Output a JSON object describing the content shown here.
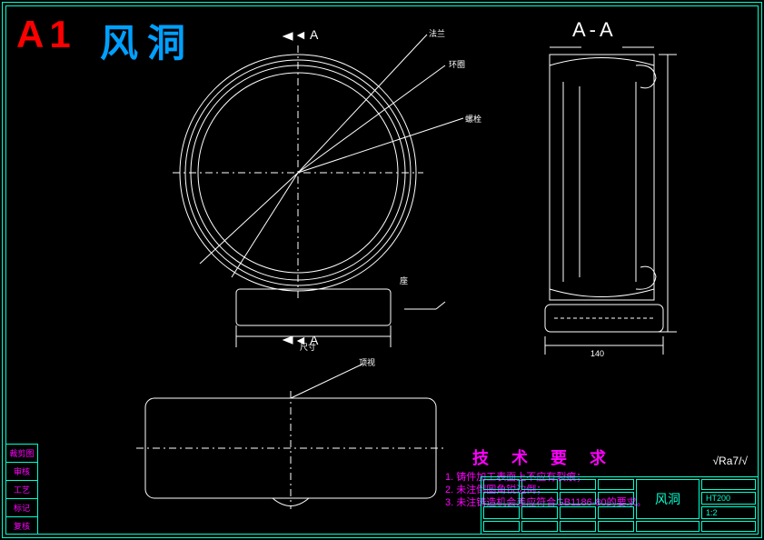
{
  "sheet": {
    "format": "A1",
    "title": "风洞",
    "section_label": "A-A",
    "arrow_label_top": "A",
    "arrow_label_bottom": "A"
  },
  "tech": {
    "heading": "技 术 要 求",
    "items": [
      "1. 铸件加工表面上不应有裂痕；",
      "2. 未注倒圆角锐边倒；",
      "3. 未注铸造机会差应符合GB1186-80的要求。"
    ]
  },
  "tolerance": "√Ra7/√",
  "left_labels": [
    "裁剪图",
    "审核",
    "工艺",
    "标记",
    "复核"
  ],
  "title_block": {
    "part": "风洞",
    "material": "HT200",
    "scale": "1:2",
    "mass": "",
    "drawing_no": ""
  },
  "callouts": {
    "c1": "法兰",
    "c2": "环圈",
    "c3": "螺栓",
    "c4": "座",
    "dim_base": "尺寸",
    "dim_side": "140"
  }
}
